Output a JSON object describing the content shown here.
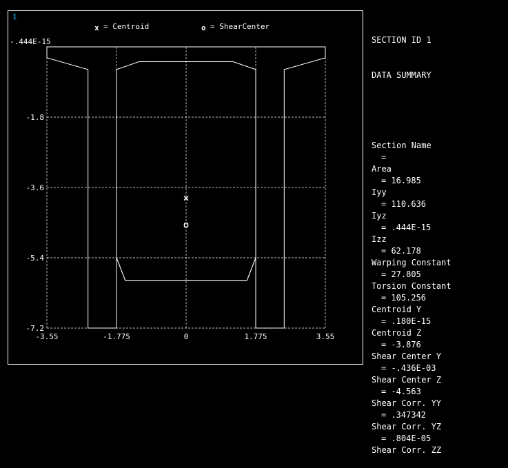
{
  "window_number": "1",
  "legend": {
    "centroid_marker": "x",
    "centroid_label": "= Centroid",
    "shear_marker": "o",
    "shear_label": "= ShearCenter"
  },
  "axes": {
    "y_top_label": "-.444E-15",
    "y_ticks": [
      {
        "value": -1.8,
        "label": "-1.8"
      },
      {
        "value": -3.6,
        "label": "-3.6"
      },
      {
        "value": -5.4,
        "label": "-5.4"
      },
      {
        "value": -7.2,
        "label": "-7.2"
      }
    ],
    "x_ticks": [
      {
        "value": -3.55,
        "label": "-3.55"
      },
      {
        "value": -1.775,
        "label": "-1.775"
      },
      {
        "value": 0,
        "label": "0"
      },
      {
        "value": 1.775,
        "label": "1.775"
      },
      {
        "value": 3.55,
        "label": "3.55"
      }
    ],
    "x_range": [
      -3.55,
      3.55
    ],
    "y_range": [
      -7.2,
      0
    ],
    "grid": true
  },
  "section": {
    "outer_boundary": [
      [
        -3.55,
        0
      ],
      [
        3.55,
        0
      ],
      [
        3.55,
        -0.28
      ],
      [
        2.5,
        -0.58
      ],
      [
        2.5,
        -7.2
      ],
      [
        1.775,
        -7.2
      ],
      [
        1.775,
        -5.4
      ],
      [
        1.55,
        -5.98
      ],
      [
        -1.55,
        -5.98
      ],
      [
        -1.775,
        -5.4
      ],
      [
        -1.775,
        -7.2
      ],
      [
        -2.5,
        -7.2
      ],
      [
        -2.5,
        -0.58
      ],
      [
        -3.55,
        -0.28
      ]
    ],
    "inner_boundary": [
      [
        -1.775,
        -0.58
      ],
      [
        -1.2,
        -0.38
      ],
      [
        1.2,
        -0.38
      ],
      [
        1.775,
        -0.58
      ],
      [
        1.775,
        -5.4
      ],
      [
        1.55,
        -5.98
      ],
      [
        -1.55,
        -5.98
      ],
      [
        -1.775,
        -5.4
      ]
    ],
    "centroid": {
      "y": 0,
      "z": -3.876
    },
    "shear_center": {
      "y": 0,
      "z": -4.563
    }
  },
  "summary": {
    "header_1": "SECTION ID 1",
    "header_2": "DATA SUMMARY",
    "items": [
      {
        "label": "Section Name",
        "value": "="
      },
      {
        "label": "Area",
        "value": "= 16.985"
      },
      {
        "label": "Iyy",
        "value": "= 110.636"
      },
      {
        "label": "Iyz",
        "value": "= .444E-15"
      },
      {
        "label": "Izz",
        "value": "= 62.178"
      },
      {
        "label": "Warping Constant",
        "value": "= 27.805"
      },
      {
        "label": "Torsion Constant",
        "value": "= 105.256"
      },
      {
        "label": "Centroid Y",
        "value": "= .180E-15"
      },
      {
        "label": "Centroid Z",
        "value": "= -3.876"
      },
      {
        "label": "Shear Center Y",
        "value": "= -.436E-03"
      },
      {
        "label": "Shear Center Z",
        "value": "= -4.563"
      },
      {
        "label": "Shear Corr. YY",
        "value": "= .347342"
      },
      {
        "label": "Shear Corr. YZ",
        "value": "= .804E-05"
      },
      {
        "label": "Shear Corr. ZZ",
        "value": ""
      }
    ]
  }
}
